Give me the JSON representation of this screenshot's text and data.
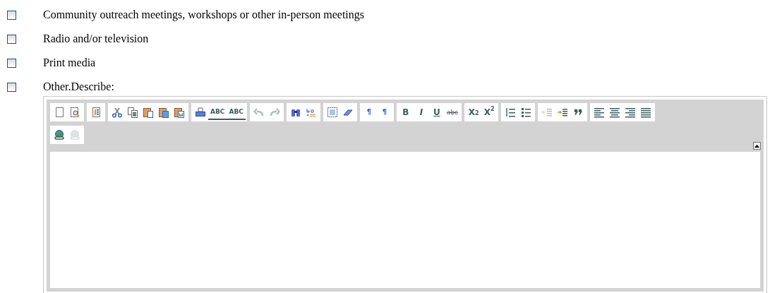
{
  "options": [
    {
      "label": "Community outreach meetings, workshops or other in-person meetings",
      "checked": false
    },
    {
      "label": "Radio and/or television",
      "checked": false
    },
    {
      "label": "Print media",
      "checked": false
    },
    {
      "label": "Other.Describe:",
      "checked": false
    }
  ],
  "editor": {
    "toolbar_rows": [
      [
        [
          {
            "kind": "new-page",
            "disabled": false
          },
          {
            "kind": "preview",
            "disabled": false
          }
        ],
        [
          {
            "kind": "templates",
            "disabled": false
          }
        ],
        [
          {
            "kind": "cut",
            "disabled": false
          },
          {
            "kind": "copy",
            "disabled": false
          },
          {
            "kind": "paste",
            "disabled": false
          },
          {
            "kind": "paste-text",
            "disabled": false
          },
          {
            "kind": "paste-word",
            "disabled": false
          }
        ],
        [
          {
            "kind": "print",
            "disabled": false
          },
          {
            "kind": "spellcheck",
            "label": "ABC",
            "disabled": false
          },
          {
            "kind": "scayt",
            "label": "ABC",
            "disabled": false
          }
        ],
        [
          {
            "kind": "undo",
            "disabled": true
          },
          {
            "kind": "redo",
            "disabled": true
          }
        ],
        [
          {
            "kind": "find",
            "disabled": false
          },
          {
            "kind": "replace",
            "disabled": false
          }
        ],
        [
          {
            "kind": "select-all",
            "disabled": false
          },
          {
            "kind": "remove-format",
            "disabled": false
          }
        ],
        [
          {
            "kind": "ltr",
            "label": "¶",
            "disabled": false
          },
          {
            "kind": "rtl",
            "label": "¶",
            "disabled": false
          }
        ],
        [
          {
            "kind": "bold",
            "label": "B",
            "disabled": false
          },
          {
            "kind": "italic",
            "label": "I",
            "disabled": false
          },
          {
            "kind": "underline",
            "label": "U",
            "disabled": false
          },
          {
            "kind": "strike",
            "label": "abc",
            "disabled": false
          }
        ],
        [
          {
            "kind": "subscript",
            "label": "X$_{2}$",
            "disabled": false
          },
          {
            "kind": "superscript",
            "label": "X$^{2}$",
            "disabled": false
          }
        ],
        [
          {
            "kind": "ordered-list",
            "disabled": false
          },
          {
            "kind": "bullet-list",
            "disabled": false
          }
        ],
        [
          {
            "kind": "outdent",
            "disabled": true
          },
          {
            "kind": "indent",
            "disabled": false
          },
          {
            "kind": "blockquote",
            "disabled": false
          }
        ],
        [
          {
            "kind": "align-left",
            "disabled": false
          },
          {
            "kind": "align-center",
            "disabled": false
          },
          {
            "kind": "align-right",
            "disabled": false
          },
          {
            "kind": "align-justify",
            "disabled": false
          }
        ]
      ],
      [
        [
          {
            "kind": "link",
            "disabled": false
          },
          {
            "kind": "unlink",
            "disabled": true
          }
        ]
      ]
    ],
    "collapsed": false
  }
}
